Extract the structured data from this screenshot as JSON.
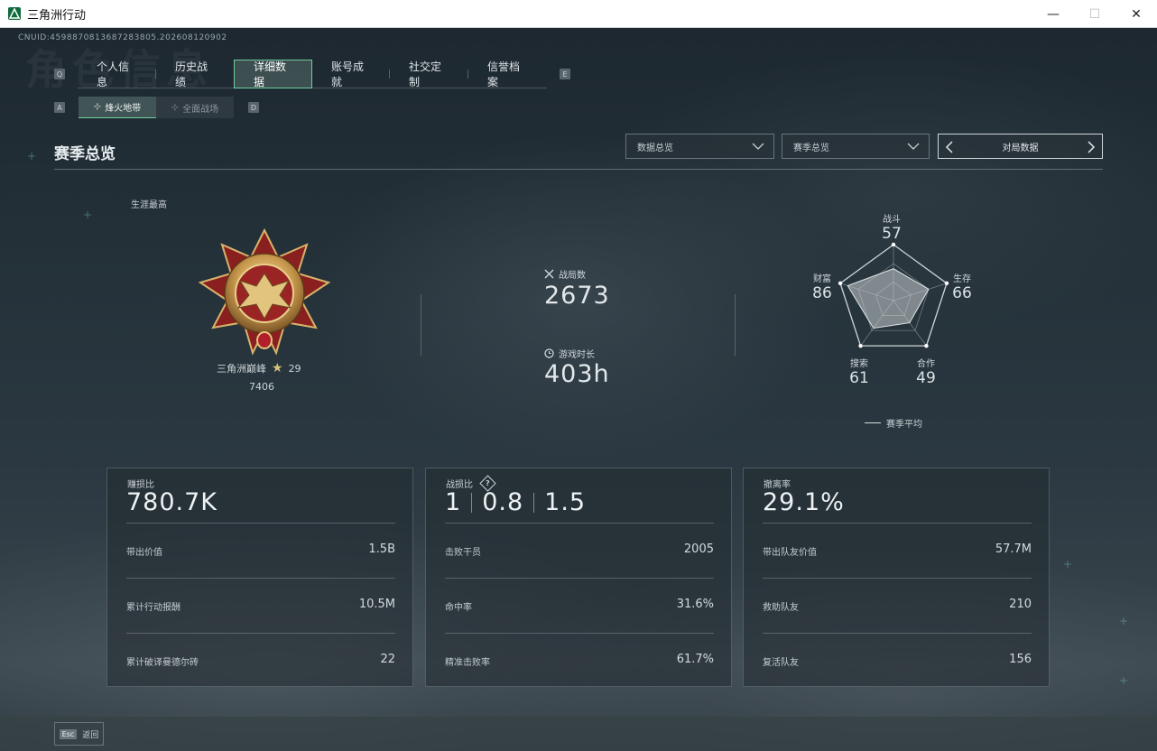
{
  "window": {
    "title": "三角洲行动",
    "minimize": "—",
    "maximize": "☐",
    "close": "✕"
  },
  "header": {
    "uid": "CNUID:4598870813687283805.202608120902",
    "bg_title": "角色信息",
    "key_left": "Q",
    "key_right": "E",
    "sub_key_left": "A",
    "sub_key_right": "D"
  },
  "main_tabs": [
    {
      "label": "个人信息"
    },
    {
      "label": "历史战绩"
    },
    {
      "label": "详细数据",
      "active": true
    },
    {
      "label": "账号成就"
    },
    {
      "label": "社交定制"
    },
    {
      "label": "信誉档案"
    }
  ],
  "sub_tabs": [
    {
      "label": "烽火地带",
      "active": true
    },
    {
      "label": "全面战场"
    }
  ],
  "section": {
    "title": "赛季总览",
    "dropdown1": "数据总览",
    "dropdown2": "赛季总览",
    "pager_label": "对局数据"
  },
  "career": {
    "label": "生涯最高",
    "rank_name": "三角洲巅峰",
    "stars": 29,
    "score": "7406"
  },
  "middle_stats": {
    "matches_label": "战局数",
    "matches_value": "2673",
    "playtime_label": "游戏时长",
    "playtime_value": "403h"
  },
  "radar": {
    "axes": [
      {
        "label": "战斗",
        "value": 57
      },
      {
        "label": "生存",
        "value": 66
      },
      {
        "label": "合作",
        "value": 49
      },
      {
        "label": "搜索",
        "value": 61
      },
      {
        "label": "财富",
        "value": 86
      }
    ],
    "max": 100,
    "legend": "赛季平均"
  },
  "cards": [
    {
      "title": "赚损比",
      "main": "780.7K",
      "rows": [
        {
          "k": "带出价值",
          "v": "1.5B"
        },
        {
          "k": "累计行动报酬",
          "v": "10.5M"
        },
        {
          "k": "累计破译曼德尔砖",
          "v": "22"
        }
      ]
    },
    {
      "title": "战损比",
      "help": "?",
      "main_parts": [
        "1",
        "0.8",
        "1.5"
      ],
      "rows": [
        {
          "k": "击败干员",
          "v": "2005"
        },
        {
          "k": "命中率",
          "v": "31.6%"
        },
        {
          "k": "精准击败率",
          "v": "61.7%"
        }
      ]
    },
    {
      "title": "撤离率",
      "main": "29.1%",
      "rows": [
        {
          "k": "带出队友价值",
          "v": "57.7M"
        },
        {
          "k": "救助队友",
          "v": "210"
        },
        {
          "k": "复活队友",
          "v": "156"
        }
      ]
    }
  ],
  "footer": {
    "esc_key": "Esc",
    "esc_label": "返回"
  },
  "colors": {
    "accent": "#6fcf9d",
    "background": "#1b242b",
    "medal_gold": "#d7b46a",
    "medal_red": "#8a1f1f"
  }
}
